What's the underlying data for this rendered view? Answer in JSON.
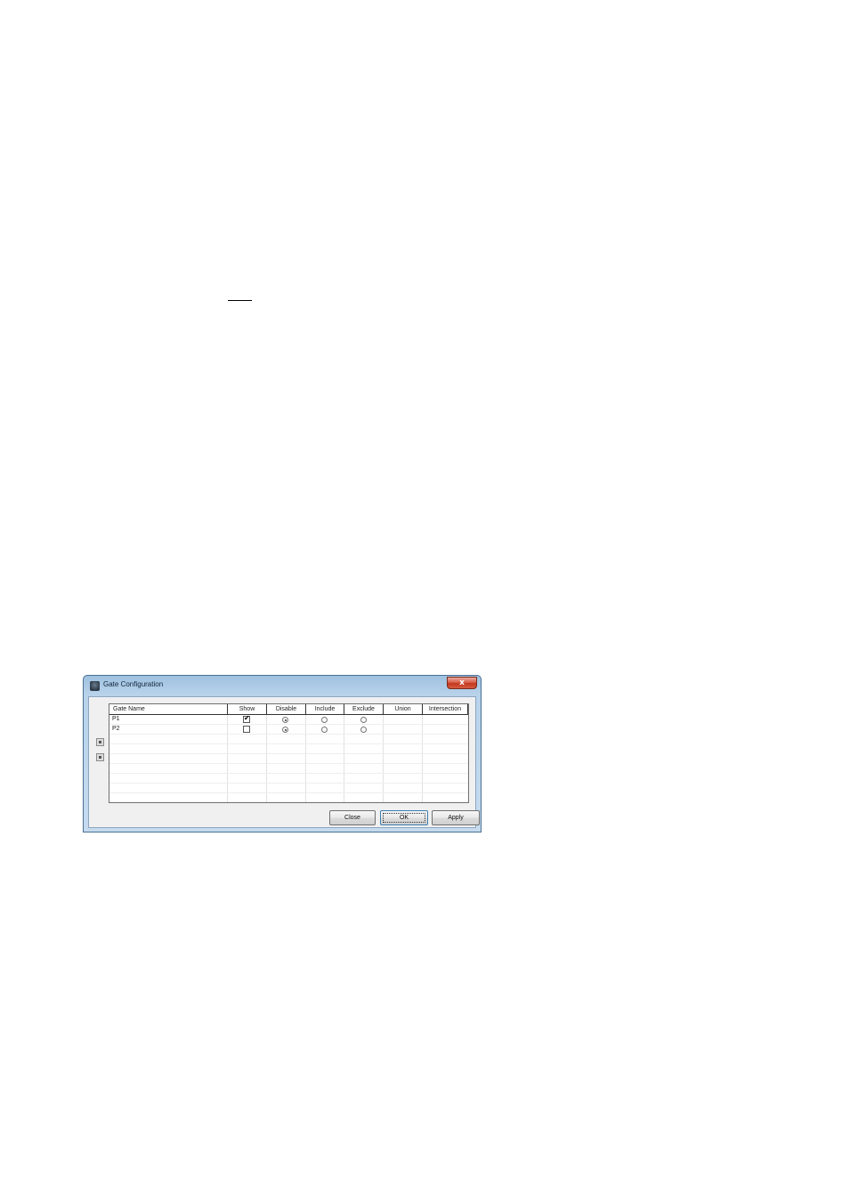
{
  "window": {
    "title": "Gate Configuration",
    "close_glyph": "x"
  },
  "table": {
    "columns": [
      "Gate Name",
      "Show",
      "Disable",
      "Include",
      "Exclude",
      "Union",
      "Intersection"
    ],
    "rows": [
      {
        "name": "P1",
        "show": true,
        "selected": "Disable"
      },
      {
        "name": "P2",
        "show": false,
        "selected": "Disable"
      }
    ]
  },
  "side_icons": [
    "save-icon",
    "load-icon"
  ],
  "buttons": {
    "close": "Close",
    "ok": "OK",
    "apply": "Apply"
  }
}
